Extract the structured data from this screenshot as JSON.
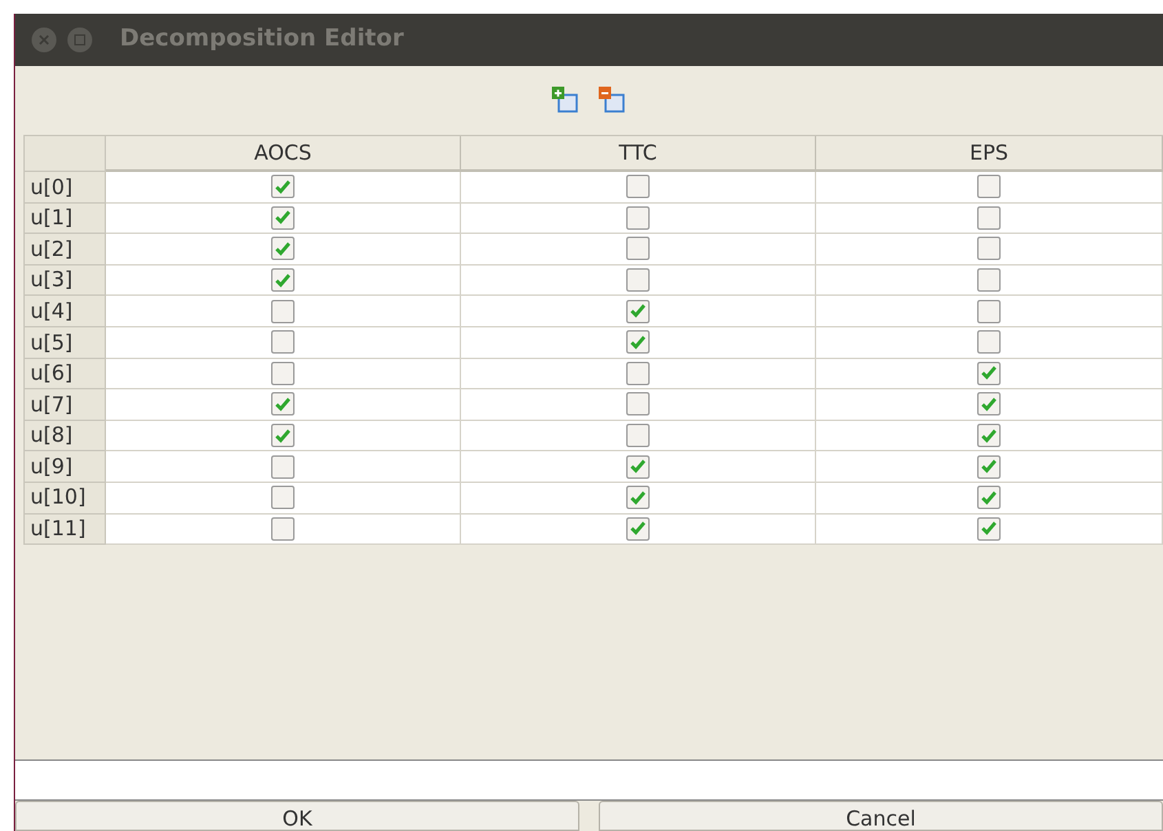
{
  "window": {
    "title": "Decomposition Editor"
  },
  "table": {
    "columns": [
      "AOCS",
      "TTC",
      "EPS"
    ],
    "rows": [
      {
        "label": "u[0]",
        "cells": [
          {
            "checked": true
          },
          {
            "checked": false
          },
          {
            "checked": false
          }
        ]
      },
      {
        "label": "u[1]",
        "cells": [
          {
            "checked": true
          },
          {
            "checked": false
          },
          {
            "checked": false
          }
        ]
      },
      {
        "label": "u[2]",
        "cells": [
          {
            "checked": true
          },
          {
            "checked": false
          },
          {
            "checked": false
          }
        ]
      },
      {
        "label": "u[3]",
        "cells": [
          {
            "checked": true
          },
          {
            "checked": false
          },
          {
            "checked": false
          }
        ]
      },
      {
        "label": "u[4]",
        "cells": [
          {
            "checked": false
          },
          {
            "checked": true
          },
          {
            "checked": false
          }
        ]
      },
      {
        "label": "u[5]",
        "cells": [
          {
            "checked": false
          },
          {
            "checked": true
          },
          {
            "checked": false
          }
        ]
      },
      {
        "label": "u[6]",
        "cells": [
          {
            "checked": false
          },
          {
            "checked": false
          },
          {
            "checked": true
          }
        ]
      },
      {
        "label": "u[7]",
        "cells": [
          {
            "checked": true
          },
          {
            "checked": false
          },
          {
            "checked": true
          }
        ]
      },
      {
        "label": "u[8]",
        "cells": [
          {
            "checked": true
          },
          {
            "checked": false
          },
          {
            "checked": true
          }
        ]
      },
      {
        "label": "u[9]",
        "cells": [
          {
            "checked": false
          },
          {
            "checked": true
          },
          {
            "checked": true
          }
        ]
      },
      {
        "label": "u[10]",
        "cells": [
          {
            "checked": false
          },
          {
            "checked": true
          },
          {
            "checked": true
          }
        ]
      },
      {
        "label": "u[11]",
        "cells": [
          {
            "checked": false
          },
          {
            "checked": true
          },
          {
            "checked": true
          }
        ]
      }
    ]
  },
  "buttons": [
    "OK",
    "Cancel"
  ]
}
